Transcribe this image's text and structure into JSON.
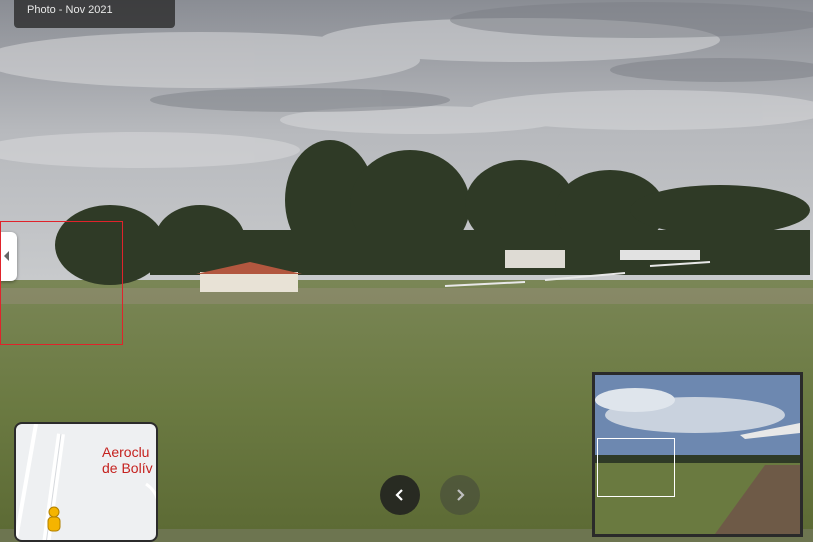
{
  "photo_date": "Photo - Nov 2021",
  "minimap": {
    "place_label_line1": "Aeroclu",
    "place_label_line2": "de Bolív",
    "pegman_icon": "pegman-icon"
  },
  "navigation": {
    "prev_icon": "chevron-left-icon",
    "next_icon": "chevron-right-icon"
  },
  "colors": {
    "badge_bg": "#282828",
    "highlight_box": "#e0232b",
    "map_label": "#c5221f",
    "pegman": "#f5b400"
  }
}
